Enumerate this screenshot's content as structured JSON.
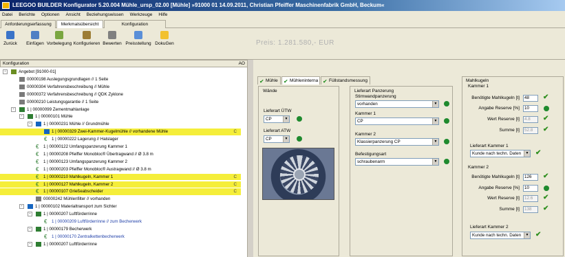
{
  "title": "LEEGOO BUILDER  Konfigurator 5.20.004 Mühle_ursp_02.00 [Mühle]  »91000 01 14.09.2011, Christian Pfeiffer Maschinenfabrik GmbH, Beckum«",
  "menu": [
    "Datei",
    "Berichte",
    "Optionen",
    "Ansicht",
    "Beziehungswissen",
    "Werkzeuge",
    "Hilfe"
  ],
  "top_tabs": [
    "Anforderungserfassung",
    "Merkmalsübersicht",
    "Konfiguration"
  ],
  "toolbar": [
    {
      "label": "Zurück",
      "icon": "back-icon"
    },
    {
      "label": "Einfügen",
      "icon": "insert-icon"
    },
    {
      "label": "Vorbelegung",
      "icon": "preset-icon"
    },
    {
      "label": "Konfigurieren",
      "icon": "configure-icon"
    },
    {
      "label": "Bewerten",
      "icon": "evaluate-icon"
    },
    {
      "label": "Preisstellung",
      "icon": "pricing-icon"
    },
    {
      "label": "DokuGen",
      "icon": "docgen-icon"
    }
  ],
  "price_text": "Preis: 1.281.580,- EUR",
  "tree_header": {
    "label": "Konfiguration",
    "ao": "AO"
  },
  "tree": [
    {
      "text": "Angebot [91000-01]",
      "level": 0,
      "exp": "-",
      "icon": "offer-icon"
    },
    {
      "text": "00000198 Auslegungsgrundlagen // 1 Seite",
      "level": 1,
      "icon": "doc-icon"
    },
    {
      "text": "00000304 Verfahrensbeschreibung // Mühle",
      "level": 1,
      "icon": "doc-icon"
    },
    {
      "text": "00000372 Verfahrensbeschreibung // QDK Zyklone",
      "level": 1,
      "icon": "doc-icon"
    },
    {
      "text": "00000210 Leistungsgarantie // 1 Seite",
      "level": 1,
      "icon": "doc-icon"
    },
    {
      "text": "1 | 00000099 Zementmahlanlage",
      "level": 1,
      "exp": "-",
      "icon": "plant-icon"
    },
    {
      "text": "1 | 00000101 Mühle",
      "level": 2,
      "exp": "-",
      "icon": "plant-icon"
    },
    {
      "text": "1 | 00000231 Mühle // Grundmühle",
      "level": 3,
      "exp": "-",
      "icon": "mill-icon"
    },
    {
      "text": "1 | 00000329 Zwei-Kammer-Kugelmühle // vorhandene Mühle",
      "level": 4,
      "icon": "mill-icon",
      "hl": true,
      "tag": "C"
    },
    {
      "text": "1 | 00000222 Lagerung // Halslager",
      "level": 4,
      "icon": "euro-icon"
    },
    {
      "text": "1 | 00000122 Umfangspanzerung Kammer 1",
      "level": 3,
      "icon": "euro-icon"
    },
    {
      "text": "1 | 00000208 Pfeiffer Monobloc® Übertragwand // Ø 3.8 m",
      "level": 3,
      "icon": "euro-icon"
    },
    {
      "text": "1 | 00000123 Umfangspanzerung Kammer 2",
      "level": 3,
      "icon": "euro-icon"
    },
    {
      "text": "1 | 00000203 Pfeiffer Monobloc® Austragwand // Ø 3.8 m",
      "level": 3,
      "icon": "euro-icon"
    },
    {
      "text": "1 | 00000210 Mahlkugeln, Kammer 1",
      "level": 3,
      "icon": "euro-icon",
      "hl": true,
      "tag": "C"
    },
    {
      "text": "1 | 00000127 Mahlkugeln, Kammer 2",
      "level": 3,
      "icon": "euro-icon",
      "hl": true,
      "tag": "C"
    },
    {
      "text": "1 | 00000107 Grießeabscheider",
      "level": 3,
      "icon": "euro-icon",
      "hl": true,
      "tag": "C"
    },
    {
      "text": "00000242 Mühlenfilter // vorhanden",
      "level": 3,
      "icon": "doc-icon"
    },
    {
      "text": "1 | 00000102 Materialtransport zum Sichter",
      "level": 2,
      "exp": "-",
      "icon": "mill-icon"
    },
    {
      "text": "1 | 00000207 Luftförderrinne",
      "level": 3,
      "exp": "-",
      "icon": "plant-icon"
    },
    {
      "text": "1 | 00000209 Luftförderrinne // zum Becherwerk",
      "level": 4,
      "icon": "euro-icon",
      "blue": true
    },
    {
      "text": "1 | 00000179 Becherwerk",
      "level": 3,
      "exp": "-",
      "icon": "plant-icon"
    },
    {
      "text": "1 | 00000170 Zentralkettenbecherwerk",
      "level": 4,
      "icon": "euro-icon",
      "blue": true
    },
    {
      "text": "1 | 00000207 Luftförderrinne",
      "level": 3,
      "exp": "-",
      "icon": "plant-icon"
    }
  ],
  "sub_tabs": [
    "Mühle",
    "Mühleninterna",
    "Füllstandsmessung"
  ],
  "waende": {
    "title": "Wände",
    "fields": [
      {
        "label": "Lieferart ÜTW",
        "value": "CP"
      },
      {
        "label": "Lieferart ATW",
        "value": "CP"
      }
    ]
  },
  "panzerung": {
    "title": "Lieferart Panzerung",
    "fields": [
      {
        "label": "Stirnwandpanzerung",
        "value": "vorhanden"
      },
      {
        "label": "Kammer 1",
        "value": "CP"
      },
      {
        "label": "Kammer 2",
        "value": "Klassierpanzerung CP"
      },
      {
        "label": "Befestigungsart",
        "value": "schraubenarm"
      }
    ]
  },
  "mahlkugeln": {
    "title": "Mahlkugeln",
    "kammer1": {
      "title": "Kammer 1",
      "rows": [
        {
          "label": "Benötigte Mahlkugeln [t]",
          "value": "48"
        },
        {
          "label": "Angabe Reserve [%]",
          "value": "10"
        },
        {
          "label": "Wert Reserve [t]",
          "value": "4.8"
        },
        {
          "label": "Summe [t]",
          "value": "52.8"
        }
      ],
      "lieferart_label": "Lieferart Kammer 1",
      "lieferart_value": "Kunde nach techn. Daten"
    },
    "kammer2": {
      "title": "Kammer 2",
      "rows": [
        {
          "label": "Benötigte Mahlkugeln [t]",
          "value": "126"
        },
        {
          "label": "Angabe Reserve [%]",
          "value": "10"
        },
        {
          "label": "Wert Reserve [t]",
          "value": "12.6"
        },
        {
          "label": "Summe [t]",
          "value": "138"
        }
      ],
      "lieferart_label": "Lieferart Kammer 2",
      "lieferart_value": "Kunde nach techn. Daten"
    }
  },
  "colors": {
    "highlight": "#f5ee3a",
    "check": "#2f8f1f",
    "title_bar": "#0a246a"
  }
}
